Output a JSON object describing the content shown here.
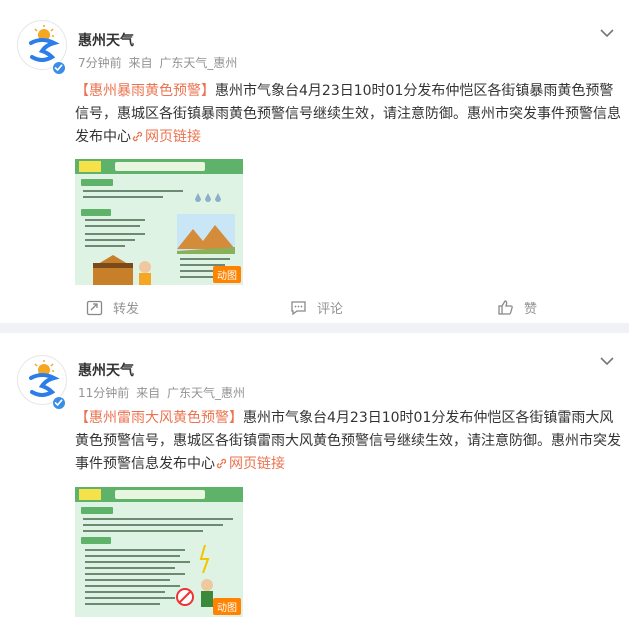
{
  "posts": [
    {
      "author": "惠州天气",
      "avatar_text": "惠州天气",
      "time": "7分钟前",
      "source_prefix": "来自",
      "source": "广东天气_惠州",
      "tag": "【惠州暴雨黄色预警】",
      "body": "惠州市气象台4月23日10时01分发布仲恺区各街镇暴雨黄色预警信号，惠城区各街镇暴雨黄色预警信号继续生效，请注意防御。惠州市突发事件预警信息发布中心",
      "link_label": "网页链接",
      "thumb_title": "暴雨黄色预警",
      "gif_label": "动图",
      "actions": {
        "repost": "转发",
        "comment": "评论",
        "like": "赞"
      }
    },
    {
      "author": "惠州天气",
      "avatar_text": "惠州天气",
      "time": "11分钟前",
      "source_prefix": "来自",
      "source": "广东天气_惠州",
      "tag": "【惠州雷雨大风黄色预警】",
      "body": "惠州市气象台4月23日10时01分发布仲恺区各街镇雷雨大风黄色预警信号，惠城区各街镇雷雨大风黄色预警信号继续生效，请注意防御。惠州市突发事件预警信息发布中心",
      "link_label": "网页链接",
      "thumb_title": "雷雨大风黄色预警",
      "gif_label": "动图"
    }
  ],
  "colors": {
    "accent": "#eb7350",
    "verified": "#3a8ee6",
    "gif": "#ff8200"
  },
  "icons": [
    "weather-logo-icon",
    "verified-icon",
    "chevron-down-icon",
    "link-icon",
    "repost-icon",
    "comment-icon",
    "like-icon"
  ]
}
